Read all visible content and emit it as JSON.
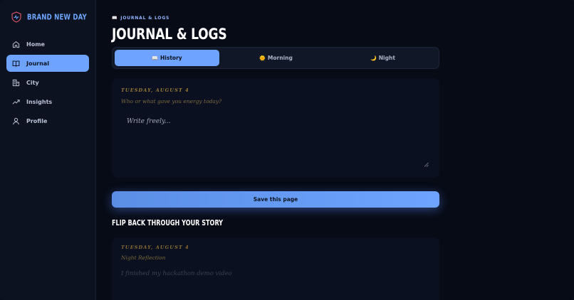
{
  "brand": {
    "name": "BRAND NEW DAY",
    "logo_icon": "heart-shield-icon"
  },
  "sidebar": {
    "items": [
      {
        "label": "Home",
        "icon": "home-icon",
        "active": false
      },
      {
        "label": "Journal",
        "icon": "book-icon",
        "active": true
      },
      {
        "label": "City",
        "icon": "buildings-icon",
        "active": false
      },
      {
        "label": "Insights",
        "icon": "trend-icon",
        "active": false
      },
      {
        "label": "Profile",
        "icon": "user-icon",
        "active": false
      }
    ]
  },
  "header": {
    "eyebrow": "JOURNAL & LOGS",
    "eyebrow_icon": "book-emoji",
    "title": "JOURNAL & LOGS"
  },
  "tabs": [
    {
      "icon": "📖",
      "label": "History",
      "active": true
    },
    {
      "icon": "🌞",
      "label": "Morning",
      "active": false
    },
    {
      "icon": "🌙",
      "label": "Night",
      "active": false
    }
  ],
  "entry": {
    "date": "TUESDAY, AUGUST 4",
    "prompt": "Who or what gave you energy today?",
    "placeholder": "Write freely...",
    "value": ""
  },
  "save_label": "Save this page",
  "history": {
    "section_title": "FLIP BACK THROUGH YOUR STORY",
    "entries": [
      {
        "date": "TUESDAY, AUGUST 4",
        "type": "Night Reflection",
        "text": "I finished my hackathon demo video"
      }
    ]
  },
  "colors": {
    "accent": "#6ea4ff",
    "background": "#070b16",
    "sidebar": "#0c1220",
    "gold_text": "#9a7a38"
  }
}
